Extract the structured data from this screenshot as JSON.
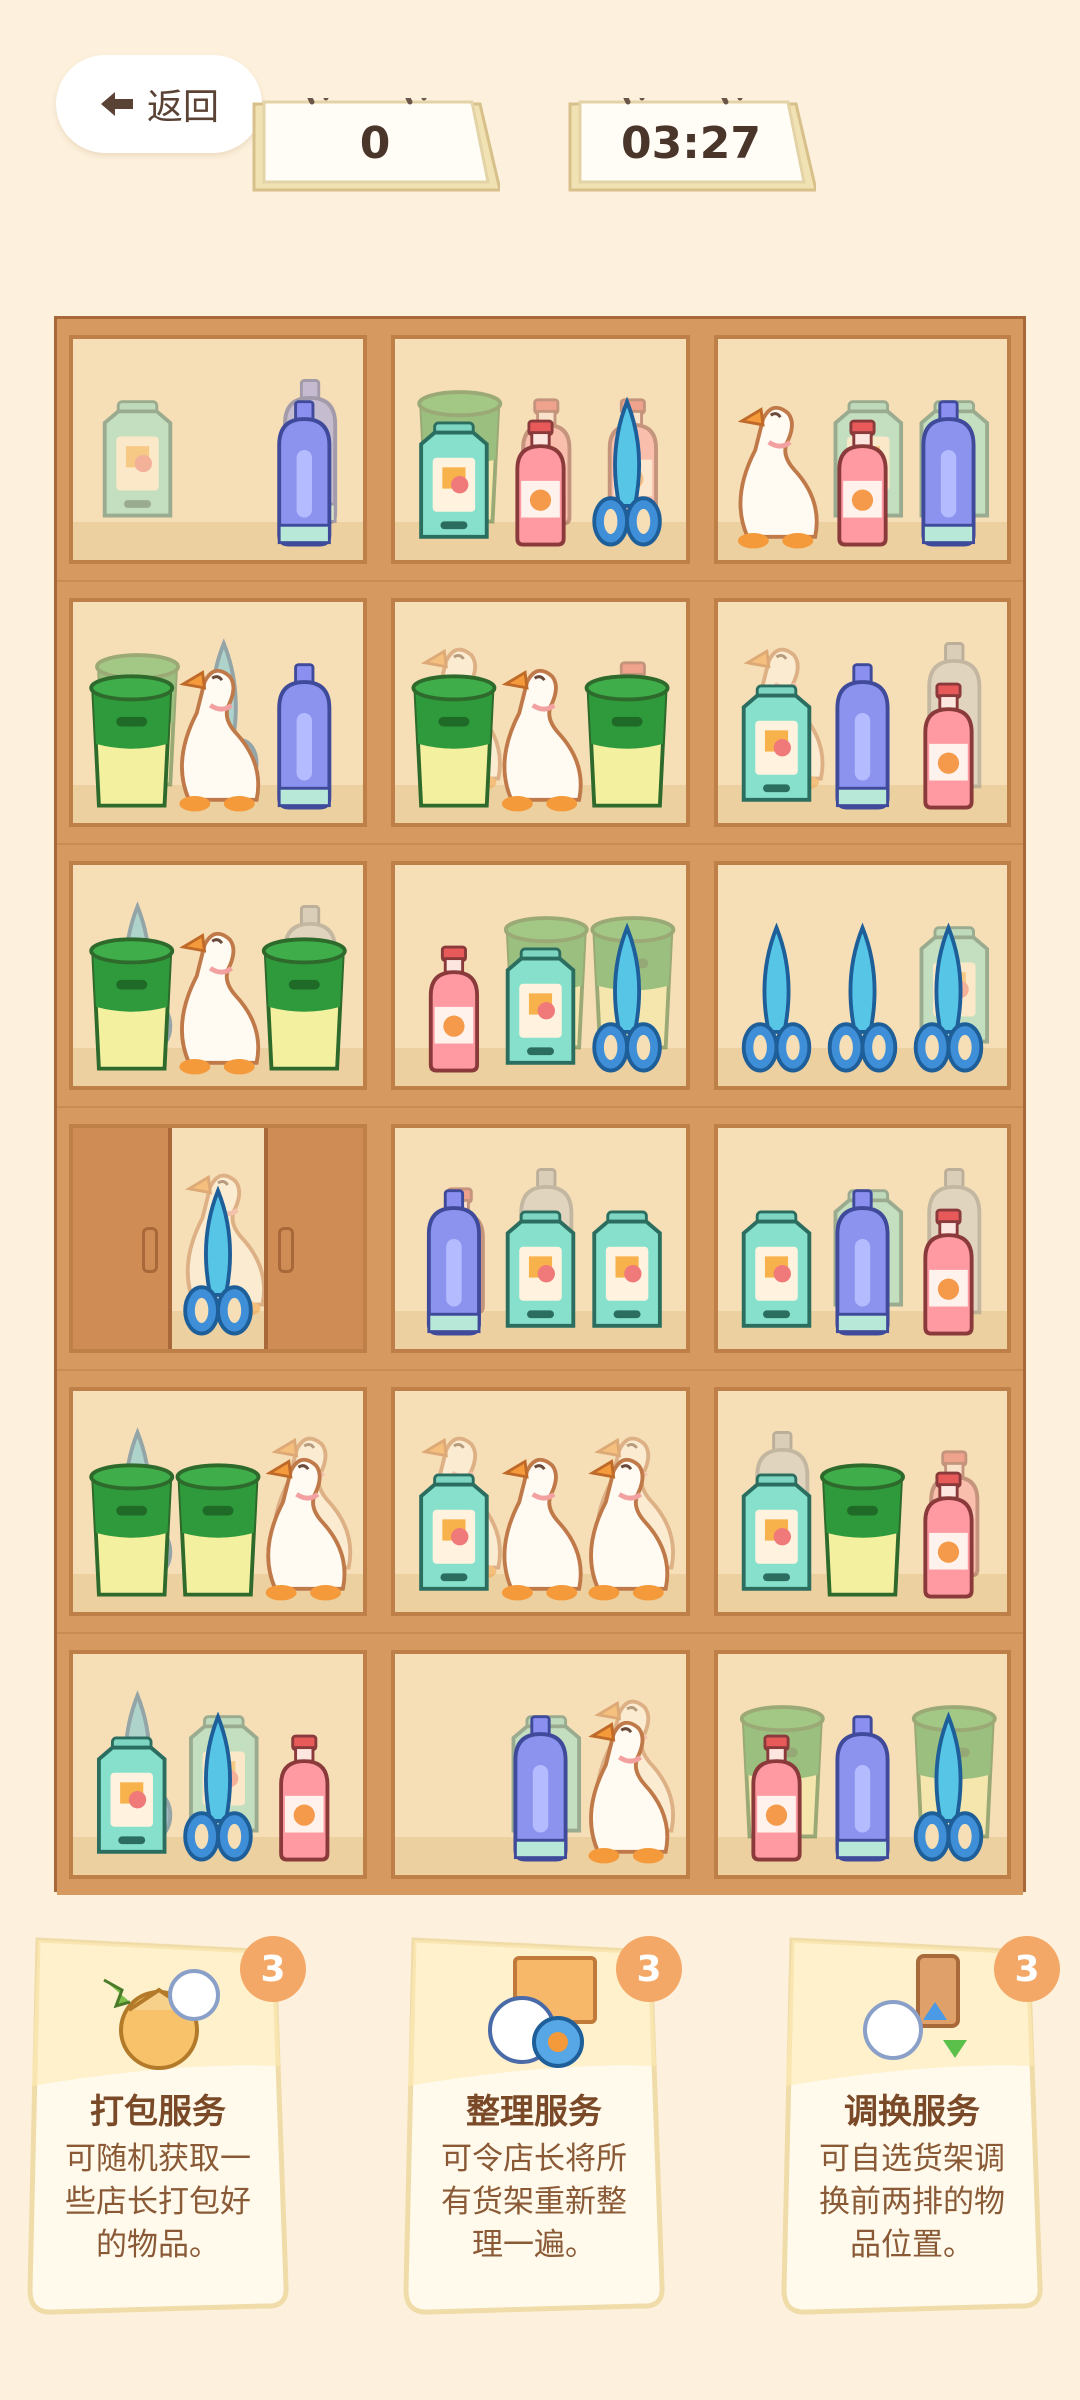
{
  "header": {
    "back_label": "返回",
    "score": "0",
    "timer": "03:27"
  },
  "shelves": [
    {
      "back": [
        "lantern",
        "",
        "bottle_blue"
      ],
      "front": [
        "",
        "",
        "bottle_blue"
      ]
    },
    {
      "back": [
        "cup",
        "juice",
        "juice"
      ],
      "front": [
        "lantern",
        "juice",
        "scissors"
      ]
    },
    {
      "back": [
        "",
        "lantern",
        "lantern"
      ],
      "front": [
        "goose",
        "juice",
        "bottle_blue"
      ]
    },
    {
      "back": [
        "cup",
        "scissors",
        ""
      ],
      "front": [
        "cup",
        "goose",
        "bottle_blue"
      ]
    },
    {
      "back": [
        "goose",
        "",
        "juice"
      ],
      "front": [
        "cup",
        "goose",
        "cup"
      ]
    },
    {
      "back": [
        "goose",
        "",
        "bottle_gray"
      ],
      "front": [
        "lantern",
        "bottle_blue",
        "juice"
      ]
    },
    {
      "back": [
        "scissors",
        "",
        "bottle_gray"
      ],
      "front": [
        "cup",
        "goose",
        "cup"
      ]
    },
    {
      "back": [
        "",
        "cup",
        "cup"
      ],
      "front": [
        "juice",
        "lantern",
        "scissors"
      ]
    },
    {
      "back": [
        "",
        "",
        "lantern"
      ],
      "front": [
        "scissors",
        "scissors",
        "scissors"
      ]
    },
    {
      "back": [
        "",
        "goose",
        ""
      ],
      "front": [
        "",
        "scissors",
        ""
      ],
      "locked": true
    },
    {
      "back": [
        "juice",
        "bottle_gray",
        ""
      ],
      "front": [
        "bottle_blue",
        "lantern",
        "lantern"
      ]
    },
    {
      "back": [
        "",
        "lantern",
        "bottle_gray"
      ],
      "front": [
        "lantern",
        "bottle_blue",
        "juice"
      ]
    },
    {
      "back": [
        "scissors",
        "",
        "goose"
      ],
      "front": [
        "cup",
        "cup",
        "goose"
      ]
    },
    {
      "back": [
        "goose",
        "",
        "goose"
      ],
      "front": [
        "lantern",
        "goose",
        "goose"
      ]
    },
    {
      "back": [
        "bottle_gray",
        "",
        "juice"
      ],
      "front": [
        "lantern",
        "cup",
        "juice"
      ]
    },
    {
      "back": [
        "scissors",
        "lantern",
        ""
      ],
      "front": [
        "lantern",
        "scissors",
        "juice"
      ]
    },
    {
      "back": [
        "",
        "lantern",
        "goose"
      ],
      "front": [
        "",
        "bottle_blue",
        "goose"
      ]
    },
    {
      "back": [
        "cup",
        "",
        "cup"
      ],
      "front": [
        "juice",
        "bottle_blue",
        "scissors"
      ]
    }
  ],
  "cards": [
    {
      "title": "打包服务",
      "desc_lines": [
        "可随机获取一",
        "些店长打包好",
        "的物品。"
      ],
      "count": "3",
      "icon": "package-icon"
    },
    {
      "title": "整理服务",
      "desc_lines": [
        "可令店长将所",
        "有货架重新整",
        "理一遍。"
      ],
      "count": "3",
      "icon": "organize-icon"
    },
    {
      "title": "调换服务",
      "desc_lines": [
        "可自选货架调",
        "换前两排的物",
        "品位置。"
      ],
      "count": "3",
      "icon": "swap-icon"
    }
  ],
  "colors": {
    "background": "#fdf1dd",
    "shelf_wood": "#d69a60",
    "shelf_inner": "#f6dfb6",
    "badge": "#f4a867"
  }
}
